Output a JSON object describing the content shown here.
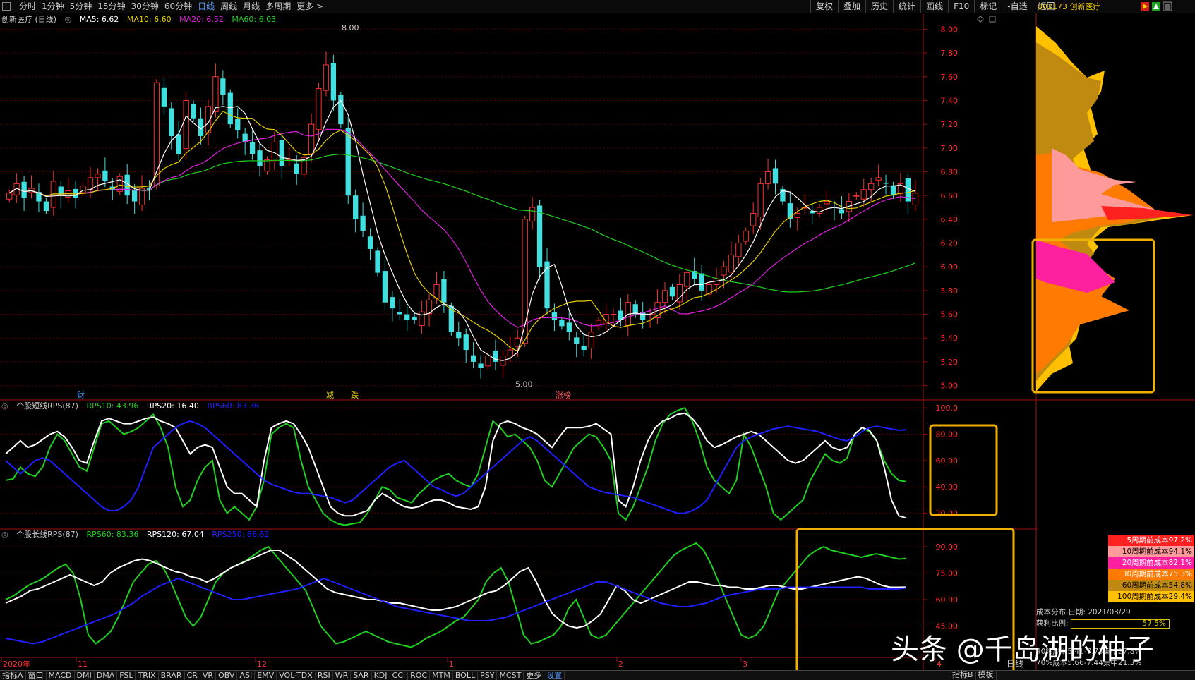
{
  "toolbar": {
    "periods": [
      "分时",
      "1分钟",
      "5分钟",
      "15分钟",
      "30分钟",
      "60分钟",
      "日线",
      "周线",
      "月线",
      "多周期",
      "更多 >"
    ],
    "active_period": "日线",
    "tools": [
      "复权",
      "叠加",
      "历史",
      "统计",
      "画线",
      "F10",
      "标记",
      "-自选",
      "返回"
    ],
    "stock_code": "002173 创新医疗"
  },
  "main_panel": {
    "stock_name": "创新医疗 (日线)",
    "ma": [
      {
        "label": "MA5: 6.62",
        "color": "#ffffff"
      },
      {
        "label": "MA10: 6.60",
        "color": "#e8d000"
      },
      {
        "label": "MA20: 6.52",
        "color": "#e020e0"
      },
      {
        "label": "MA60: 6.03",
        "color": "#20d020"
      }
    ],
    "high_label": "8.00",
    "low_label": "5.00",
    "event_markers": [
      {
        "text": "财",
        "color": "#5ea0ff"
      },
      {
        "text": "减",
        "color": "#e8d000"
      },
      {
        "text": "跌",
        "color": "#e8d000"
      },
      {
        "text": "涨榜",
        "color": "#ff6060"
      }
    ]
  },
  "rps_short": {
    "title": "个股短线RPS(87)",
    "rps10": "RPS10: 43.96",
    "rps20": "RPS20: 16.40",
    "rps60": "RPS60: 83.36"
  },
  "rps_long": {
    "title": "个股长线RPS(87)",
    "rps60": "RPS60: 83.36",
    "rps120": "RPS120: 67.04",
    "rps250": "RPS250: 66.62"
  },
  "chart_data": [
    {
      "type": "candlestick",
      "title": "创新医疗 (日线)",
      "y_ticks": [
        "8.00",
        "7.80",
        "7.60",
        "7.40",
        "7.20",
        "7.00",
        "6.80",
        "6.60",
        "6.40",
        "6.20",
        "6.00",
        "5.80",
        "5.60",
        "5.40",
        "5.20",
        "5.00"
      ],
      "ylim": [
        4.95,
        8.05
      ],
      "x_ticks": [
        "2020年",
        "11",
        "12",
        "1",
        "2",
        "3",
        "4"
      ],
      "closes": [
        6.62,
        6.7,
        6.58,
        6.66,
        6.55,
        6.47,
        6.72,
        6.6,
        6.64,
        6.58,
        6.68,
        6.75,
        6.78,
        6.72,
        6.65,
        6.76,
        6.6,
        6.55,
        6.66,
        6.65,
        7.55,
        7.35,
        7.1,
        6.95,
        7.4,
        7.25,
        7.1,
        7.35,
        7.6,
        7.45,
        7.2,
        7.15,
        7.05,
        6.95,
        6.85,
        6.9,
        7.05,
        6.85,
        6.9,
        6.78,
        6.92,
        7.2,
        7.5,
        7.7,
        7.4,
        7.2,
        6.6,
        6.4,
        6.3,
        6.15,
        5.95,
        5.7,
        5.65,
        5.6,
        5.55,
        5.55,
        5.62,
        5.72,
        5.85,
        5.7,
        5.45,
        5.4,
        5.3,
        5.2,
        5.15,
        5.25,
        5.2,
        5.25,
        5.3,
        5.4,
        6.4,
        6.5,
        6.0,
        5.65,
        5.55,
        5.5,
        5.45,
        5.35,
        5.3,
        5.45,
        5.55,
        5.6,
        5.6,
        5.55,
        5.7,
        5.6,
        5.55,
        5.6,
        5.7,
        5.8,
        5.75,
        5.85,
        5.95,
        5.9,
        5.8,
        5.85,
        5.9,
        6.0,
        6.1,
        6.2,
        6.3,
        6.45,
        6.7,
        6.8,
        6.7,
        6.55,
        6.4,
        6.45,
        6.5,
        6.45,
        6.5,
        6.55,
        6.5,
        6.45,
        6.55,
        6.6,
        6.65,
        6.7,
        6.75,
        6.7,
        6.6,
        6.7,
        6.55,
        6.62
      ]
    },
    {
      "type": "line",
      "title": "个股短线RPS(87)",
      "y_ticks": [
        "100.0",
        "80.00",
        "60.00",
        "40.00",
        "20.00"
      ],
      "ylim": [
        8,
        106
      ],
      "series": [
        {
          "name": "RPS10",
          "color": "#20d020",
          "values": [
            45,
            46,
            55,
            50,
            48,
            55,
            70,
            80,
            75,
            65,
            55,
            52,
            70,
            88,
            90,
            85,
            80,
            82,
            85,
            90,
            95,
            85,
            70,
            40,
            25,
            30,
            45,
            55,
            60,
            30,
            20,
            25,
            20,
            15,
            25,
            45,
            80,
            85,
            88,
            85,
            60,
            40,
            30,
            20,
            15,
            12,
            11,
            12,
            13,
            20,
            30,
            40,
            38,
            32,
            30,
            28,
            35,
            40,
            45,
            48,
            50,
            45,
            42,
            40,
            50,
            70,
            90,
            85,
            78,
            80,
            75,
            70,
            60,
            45,
            40,
            50,
            60,
            70,
            75,
            80,
            78,
            70,
            60,
            20,
            15,
            25,
            40,
            55,
            75,
            88,
            95,
            98,
            100,
            90,
            75,
            55,
            45,
            40,
            35,
            45,
            80,
            70,
            55,
            40,
            20,
            15,
            20,
            25,
            30,
            45,
            55,
            65,
            60,
            58,
            62,
            80,
            85,
            82,
            75,
            60,
            50,
            45,
            43.96
          ]
        },
        {
          "name": "RPS20",
          "color": "#ffffff",
          "values": [
            65,
            70,
            75,
            70,
            72,
            76,
            80,
            82,
            78,
            70,
            60,
            58,
            75,
            90,
            92,
            90,
            88,
            88,
            90,
            92,
            93,
            90,
            88,
            85,
            75,
            65,
            70,
            72,
            70,
            55,
            40,
            35,
            35,
            30,
            25,
            60,
            85,
            88,
            90,
            88,
            80,
            70,
            55,
            40,
            25,
            20,
            18,
            18,
            20,
            22,
            30,
            35,
            32,
            28,
            25,
            24,
            25,
            28,
            30,
            30,
            28,
            25,
            24,
            23,
            25,
            40,
            75,
            88,
            90,
            88,
            85,
            83,
            80,
            75,
            70,
            78,
            85,
            85,
            85,
            86,
            88,
            84,
            80,
            30,
            25,
            40,
            60,
            75,
            85,
            90,
            92,
            95,
            96,
            92,
            85,
            75,
            70,
            72,
            75,
            78,
            80,
            82,
            80,
            75,
            70,
            65,
            60,
            58,
            60,
            65,
            70,
            75,
            70,
            68,
            70,
            80,
            85,
            83,
            75,
            55,
            30,
            18,
            16.4
          ]
        },
        {
          "name": "RPS60",
          "color": "#2020ff",
          "values": [
            60,
            55,
            50,
            55,
            60,
            62,
            60,
            55,
            50,
            45,
            40,
            35,
            30,
            25,
            22,
            22,
            25,
            30,
            40,
            55,
            70,
            75,
            80,
            85,
            88,
            90,
            88,
            85,
            80,
            75,
            70,
            65,
            60,
            55,
            50,
            45,
            42,
            40,
            38,
            36,
            35,
            35,
            34,
            33,
            32,
            30,
            28,
            30,
            35,
            40,
            45,
            50,
            55,
            58,
            60,
            55,
            50,
            45,
            40,
            38,
            35,
            33,
            35,
            40,
            45,
            50,
            55,
            60,
            65,
            70,
            75,
            78,
            75,
            70,
            65,
            60,
            55,
            50,
            45,
            40,
            38,
            36,
            35,
            34,
            33,
            32,
            30,
            28,
            26,
            24,
            22,
            20,
            20,
            22,
            25,
            30,
            40,
            50,
            60,
            70,
            75,
            78,
            80,
            82,
            84,
            85,
            86,
            85,
            84,
            83,
            82,
            80,
            78,
            76,
            75,
            78,
            82,
            85,
            86,
            85,
            84,
            83,
            83.36
          ]
        }
      ]
    },
    {
      "type": "line",
      "title": "个股长线RPS(87)",
      "y_ticks": [
        "90.00",
        "75.00",
        "60.00",
        "45.00"
      ],
      "ylim": [
        28,
        100
      ],
      "series": [
        {
          "name": "RPS60",
          "color": "#20d020",
          "values": [
            60,
            62,
            65,
            68,
            70,
            72,
            75,
            78,
            80,
            75,
            60,
            40,
            35,
            38,
            42,
            50,
            60,
            70,
            75,
            80,
            82,
            78,
            70,
            60,
            50,
            45,
            50,
            60,
            70,
            75,
            78,
            80,
            82,
            85,
            88,
            90,
            85,
            80,
            75,
            70,
            65,
            55,
            45,
            40,
            35,
            36,
            38,
            40,
            42,
            40,
            38,
            36,
            35,
            34,
            33,
            35,
            38,
            40,
            42,
            45,
            48,
            50,
            55,
            60,
            70,
            75,
            78,
            70,
            55,
            40,
            35,
            36,
            38,
            40,
            45,
            55,
            60,
            50,
            40,
            38,
            40,
            45,
            50,
            55,
            60,
            65,
            70,
            75,
            80,
            85,
            88,
            90,
            92,
            88,
            80,
            70,
            60,
            50,
            40,
            38,
            40,
            45,
            55,
            65,
            70,
            75,
            80,
            85,
            88,
            90,
            88,
            87,
            86,
            85,
            84,
            85,
            86,
            85,
            84,
            83,
            83.36
          ]
        },
        {
          "name": "RPS120",
          "color": "#ffffff",
          "values": [
            58,
            60,
            62,
            65,
            66,
            68,
            70,
            72,
            74,
            72,
            70,
            68,
            70,
            75,
            78,
            80,
            82,
            83,
            82,
            80,
            78,
            76,
            75,
            73,
            72,
            70,
            72,
            75,
            78,
            80,
            82,
            84,
            86,
            88,
            88,
            85,
            82,
            78,
            74,
            70,
            66,
            64,
            63,
            62,
            61,
            60,
            60,
            59,
            58,
            58,
            57,
            56,
            55,
            54,
            54,
            55,
            56,
            58,
            60,
            62,
            64,
            65,
            68,
            72,
            76,
            78,
            70,
            60,
            52,
            48,
            45,
            44,
            45,
            48,
            52,
            60,
            68,
            65,
            60,
            58,
            60,
            62,
            64,
            66,
            68,
            70,
            70,
            69,
            68,
            68,
            67,
            67,
            66,
            66,
            67,
            68,
            68,
            67,
            66,
            66,
            67,
            68,
            69,
            70,
            71,
            72,
            73,
            72,
            70,
            68,
            67,
            67,
            67.04
          ]
        },
        {
          "name": "RPS250",
          "color": "#2020ff",
          "values": [
            38,
            37,
            36,
            35,
            36,
            38,
            40,
            42,
            44,
            46,
            48,
            50,
            52,
            55,
            58,
            62,
            65,
            68,
            70,
            72,
            70,
            68,
            66,
            64,
            62,
            60,
            60,
            61,
            62,
            63,
            64,
            65,
            66,
            68,
            70,
            72,
            70,
            68,
            66,
            64,
            62,
            60,
            58,
            56,
            55,
            54,
            53,
            52,
            51,
            50,
            49,
            48,
            48,
            48,
            49,
            50,
            52,
            54,
            56,
            58,
            60,
            62,
            64,
            66,
            68,
            70,
            70,
            68,
            66,
            64,
            62,
            60,
            58,
            57,
            56,
            56,
            57,
            58,
            60,
            62,
            63,
            64,
            65,
            66,
            66,
            66,
            67,
            67,
            67,
            67,
            67,
            67,
            67,
            67,
            67,
            66,
            66,
            66,
            66,
            66.62
          ]
        }
      ]
    }
  ],
  "cost_legend": [
    {
      "label": "5周期前成本97.2%",
      "color": "#ff2020"
    },
    {
      "label": "10周期前成本94.1%",
      "color": "#ff9a9a"
    },
    {
      "label": "20周期前成本82.1%",
      "color": "#ff20a0"
    },
    {
      "label": "30周期前成本75.3%",
      "color": "#ff7a00"
    },
    {
      "label": "60周期前成本54.8%",
      "color": "#c08a10"
    },
    {
      "label": "100周期前成本29.4%",
      "color": "#ffc000"
    }
  ],
  "cost_info": {
    "date_label": "成本分布,日期: 2021/03/29",
    "profit_label": "获利比例:",
    "profit_value": "57.5%",
    "row3": "90%成本5.41-7.73集中27.8%",
    "row4": "70%成本5.66-7.44集中21.3%"
  },
  "bottom_tabs": [
    "指标A",
    "窗口",
    "MACD",
    "DMI",
    "DMA",
    "FSL",
    "TRIX",
    "BRAR",
    "CR",
    "VR",
    "OBV",
    "ASI",
    "EMV",
    "VOL-TDX",
    "RSI",
    "WR",
    "SAR",
    "KDJ",
    "CCI",
    "ROC",
    "MTM",
    "BOLL",
    "PSY",
    "MCST",
    "更多",
    "设置"
  ],
  "bottom_right": {
    "tab1": "指标B",
    "tab2": "模板",
    "day_label": "日线"
  },
  "watermark": "头条 @千岛湖的柚子"
}
